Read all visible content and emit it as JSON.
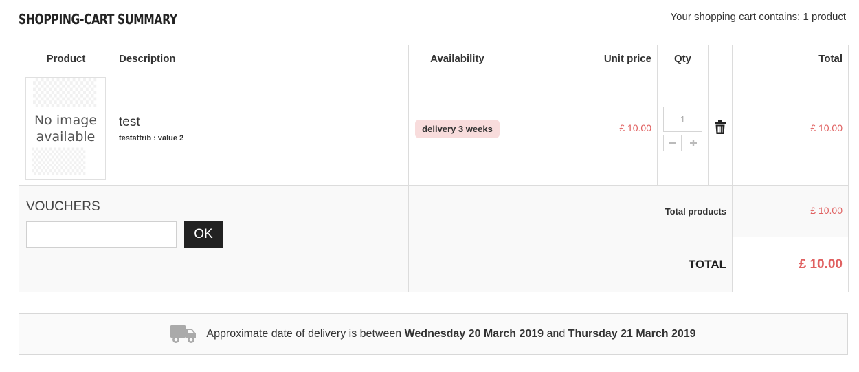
{
  "header": {
    "title": "SHOPPING-CART SUMMARY",
    "cart_count": "Your shopping cart contains: 1 product"
  },
  "table": {
    "columns": {
      "product": "Product",
      "description": "Description",
      "availability": "Availability",
      "unit_price": "Unit price",
      "qty": "Qty",
      "total": "Total"
    },
    "item": {
      "image_placeholder": "No image available",
      "name": "test",
      "attribute": "testattrib : value 2",
      "availability": "delivery 3 weeks",
      "unit_price": "£ 10.00",
      "quantity": "1",
      "total": "£ 10.00",
      "delete_icon": "trash-icon"
    }
  },
  "vouchers": {
    "title": "VOUCHERS",
    "input_value": "",
    "ok_label": "OK"
  },
  "summary": {
    "total_products_label": "Total products",
    "total_products_value": "£ 10.00",
    "total_label": "TOTAL",
    "total_value": "£ 10.00"
  },
  "delivery": {
    "icon": "truck-icon",
    "text_prefix": "Approximate date of delivery is between",
    "date_from": "Wednesday 20 March 2019",
    "text_mid": "and",
    "date_to": "Thursday 21 March 2019"
  },
  "colors": {
    "price_red": "#e06060",
    "badge_bg": "#f8dcdc",
    "ok_button_bg": "#222222"
  }
}
